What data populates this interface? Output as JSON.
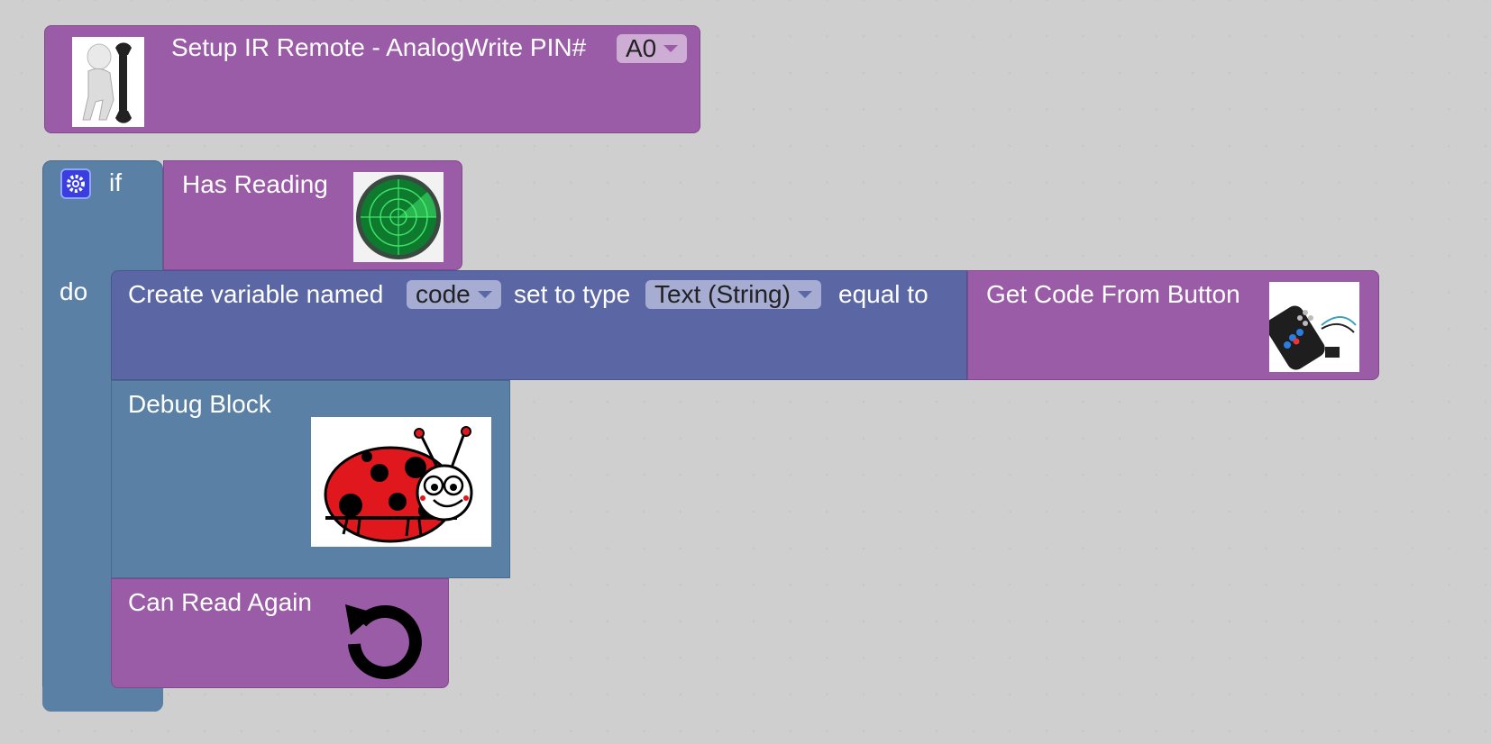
{
  "setup_block": {
    "label": "Setup IR Remote - AnalogWrite PIN#",
    "pin_value": "A0",
    "icon": "mechanic-wrench-figure-icon"
  },
  "if_block": {
    "if_label": "if",
    "do_label": "do",
    "icon": "gear-icon"
  },
  "has_reading_block": {
    "label": "Has Reading",
    "icon": "radar-icon"
  },
  "create_variable_block": {
    "label_prefix": "Create variable named",
    "variable_name": "code",
    "label_middle": "set to type",
    "type_value": "Text (String)",
    "label_suffix": "equal to"
  },
  "get_code_block": {
    "label": "Get Code From Button",
    "icon": "ir-remote-icon"
  },
  "debug_block": {
    "label": "Debug Block",
    "icon": "ladybug-icon"
  },
  "can_read_again_block": {
    "label": "Can Read Again",
    "icon": "refresh-icon"
  },
  "colors": {
    "purple": "#9b5ca7",
    "blue": "#5b80a5",
    "indigo": "#5b67a5"
  }
}
